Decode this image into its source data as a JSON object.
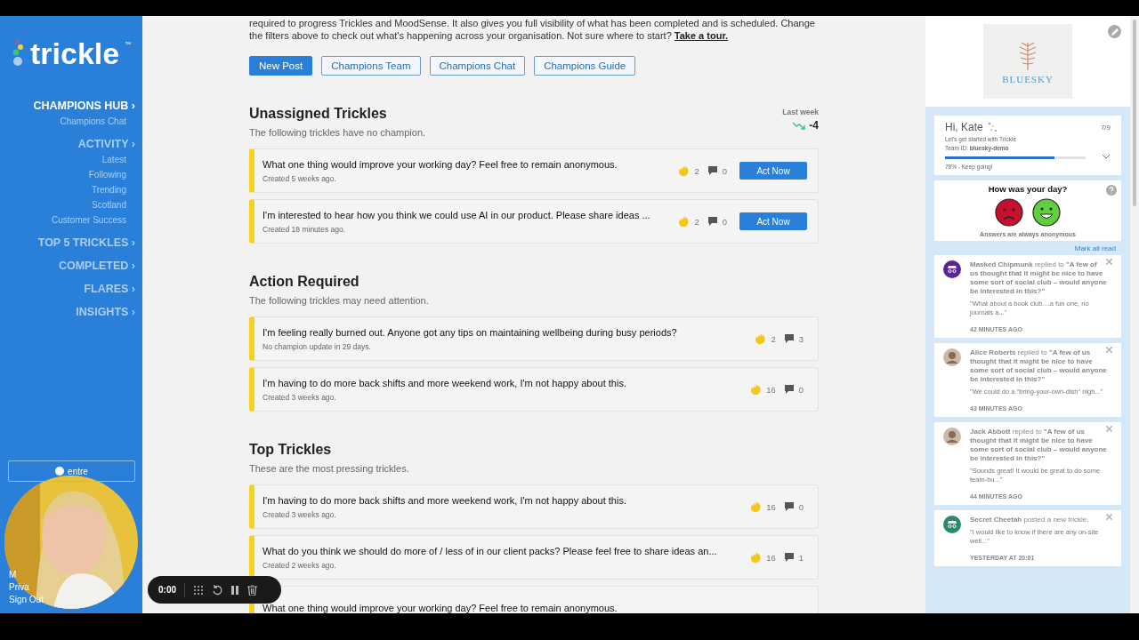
{
  "sidebar": {
    "logo": "trickle",
    "trademark": "™",
    "sections": [
      {
        "label": "CHAMPIONS HUB",
        "arrow": "›",
        "selected": true,
        "items": [
          "Champions Chat"
        ]
      },
      {
        "label": "ACTIVITY",
        "arrow": "›",
        "selected": false,
        "items": [
          "Latest",
          "Following",
          "Trending",
          "Scotland",
          "Customer Success"
        ]
      },
      {
        "label": "TOP 5 TRICKLES",
        "arrow": "›",
        "selected": false
      },
      {
        "label": "COMPLETED",
        "arrow": "›",
        "selected": false
      },
      {
        "label": "FLARES",
        "arrow": "›",
        "selected": false
      },
      {
        "label": "INSIGHTS",
        "arrow": "›",
        "selected": false
      }
    ],
    "help_button": "entre",
    "footer_links": [
      "M",
      "Priva",
      "Sign Out"
    ]
  },
  "intro": {
    "lines": [
      "required to progress Trickles and MoodSense. It also gives you full visibility of what has been completed and is scheduled. Change",
      "the filters above to check out what's happening across your organisation. Not sure where to start?"
    ],
    "link": "Take a tour."
  },
  "actions": [
    {
      "label": "New Post",
      "kind": "primary"
    },
    {
      "label": "Champions Team",
      "kind": "outline"
    },
    {
      "label": "Champions Chat",
      "kind": "outline"
    },
    {
      "label": "Champions Guide",
      "kind": "outline"
    }
  ],
  "sections": [
    {
      "title": "Unassigned Trickles",
      "subtitle": "The following trickles have no champion.",
      "stat": {
        "label": "Last week",
        "value": "-4"
      },
      "cards": [
        {
          "title": "What one thing would improve your working day? Feel free to remain anonymous.",
          "meta": "Created 5 weeks ago.",
          "likes": "2",
          "comments": "0",
          "button": "Act Now"
        },
        {
          "title": "I'm interested to hear how you think we could use AI in our product. Please share ideas ...",
          "meta": "Created 18 minutes ago.",
          "likes": "2",
          "comments": "0",
          "button": "Act Now"
        }
      ]
    },
    {
      "title": "Action Required",
      "subtitle": "The following trickles may need attention.",
      "cards": [
        {
          "title": "I'm feeling really burned out. Anyone got any tips on maintaining wellbeing during busy periods?",
          "meta": "No champion update in 29 days.",
          "likes": "2",
          "comments": "3"
        },
        {
          "title": "I'm having to do more back shifts and more weekend work, I'm not happy about this.",
          "meta": "Created 3 weeks ago.",
          "likes": "16",
          "comments": "0"
        }
      ]
    },
    {
      "title": "Top Trickles",
      "subtitle": "These are the most pressing trickles.",
      "cards": [
        {
          "title": "I'm having to do more back shifts and more weekend work, I'm not happy about this.",
          "meta": "Created 3 weeks ago.",
          "likes": "16",
          "comments": "0"
        },
        {
          "title": "What do you think we should do more of / less of in our client packs? Please feel free to share ideas an...",
          "meta": "Created 2 weeks ago.",
          "likes": "16",
          "comments": "1"
        },
        {
          "title": "What one thing would improve your working day? Feel free to remain anonymous."
        }
      ]
    }
  ],
  "recorder": {
    "time": "0:00"
  },
  "panel": {
    "brand": "BLUESKY",
    "onboarding": {
      "greeting": "Hi, Kate",
      "progress_count": "7/9",
      "line": "Let's get started with Trickle",
      "team": "Team ID: **bluesky-demo**",
      "level": 0.78,
      "status": "78% - Keep going!"
    },
    "mood": {
      "question": "How was your day?",
      "note": "Answers are always anonymous"
    },
    "mark_all": "Mark all read",
    "notifications": [
      {
        "kind": "mask",
        "color": "#5a2590",
        "text": "**Masked Chipmunk** replied to **\"A few of us thought that it might be nice to have some sort of social club – would anyone be interested in this?\"**",
        "excerpt": "\"What about a book club....a fun one, no journals a...\"",
        "time": "42 MINUTES AGO"
      },
      {
        "text": "**Alice Roberts** replied to **\"A few of us thought that it might be nice to have some sort of social club – would anyone be interested in this?\"**",
        "excerpt": "\"We could do a \"bring-your-own-dish\" nigh...\"",
        "time": "43 MINUTES AGO"
      },
      {
        "text": "**Jack Abbott** replied to **\"A few of us thought that it might be nice to have some sort of social club – would anyone be interested in this?\"**",
        "excerpt": "\"Sounds great! It would be great to do some team-bu...\"",
        "time": "44 MINUTES AGO"
      },
      {
        "kind": "mask",
        "color": "#2a8a6a",
        "text": "**Secret Cheetah** posted a new trickle.",
        "excerpt": "\"I would like to know if there are any on-site well...\"",
        "time": "YESTERDAY AT 20:01"
      }
    ]
  }
}
